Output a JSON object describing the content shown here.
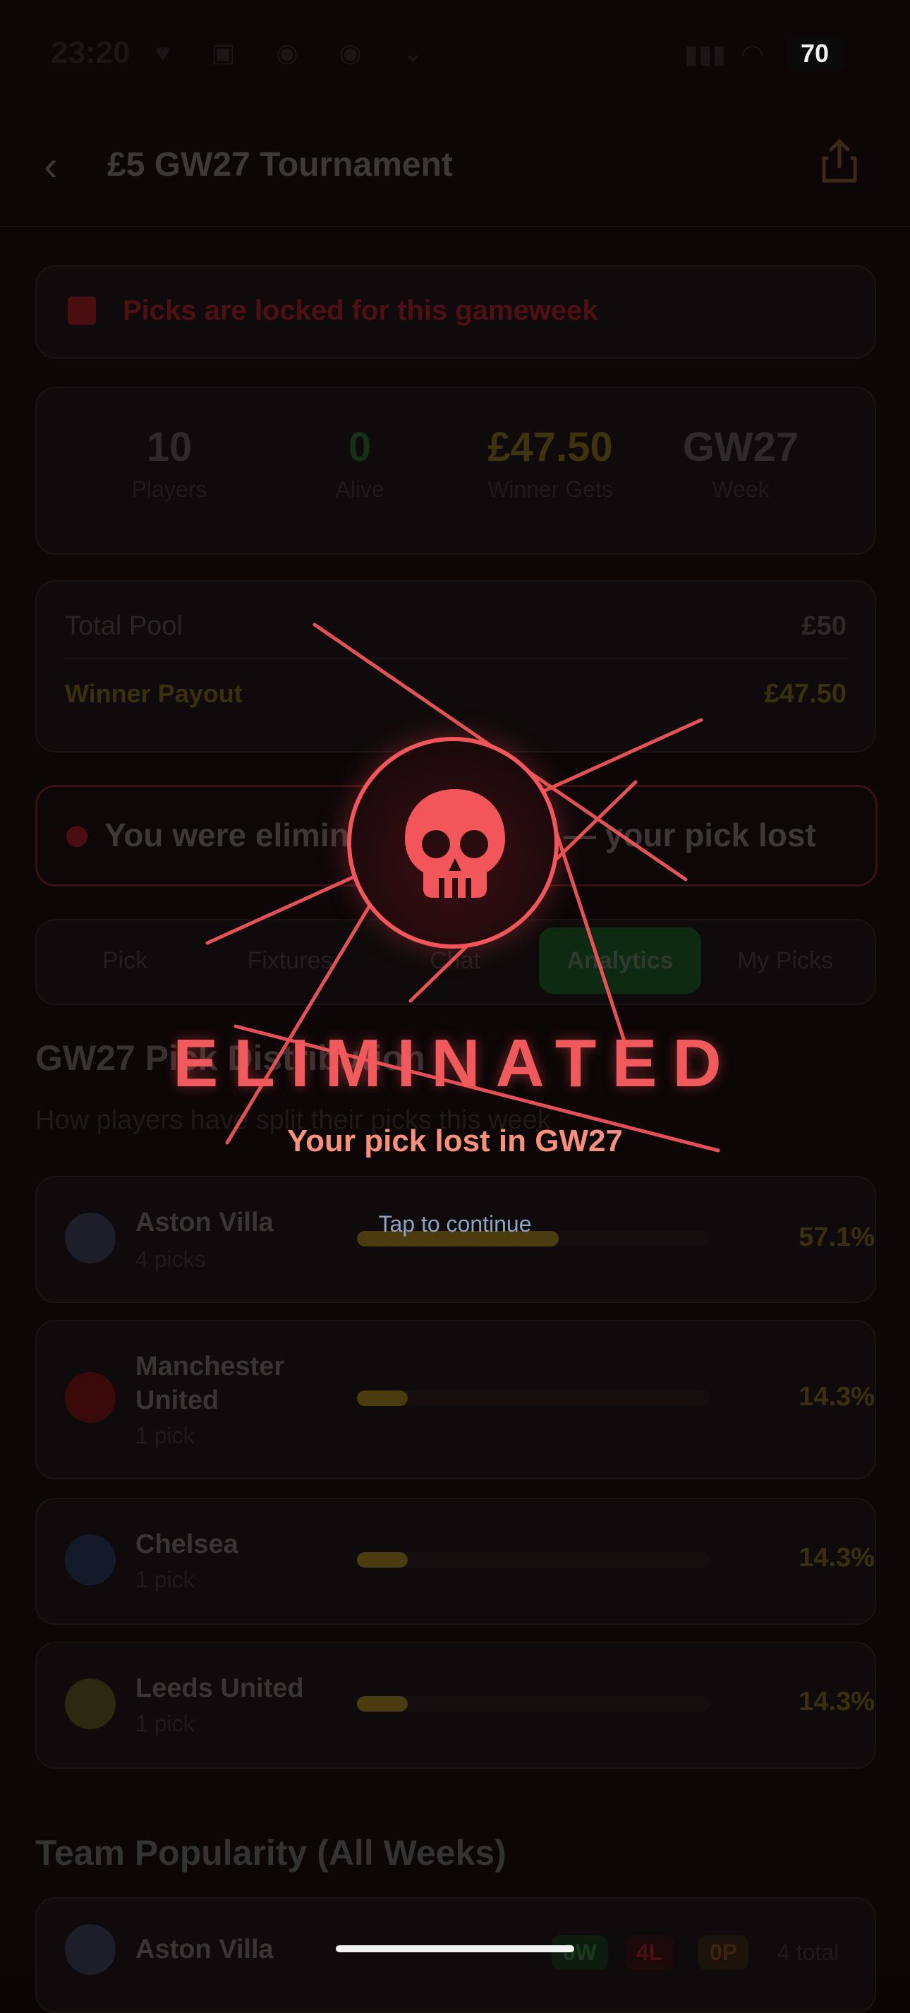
{
  "status_bar": {
    "time": "23:20",
    "battery": "70"
  },
  "header": {
    "back_icon": "chevron-left-icon",
    "title": "£5 GW27 Tournament",
    "share_icon": "share-icon"
  },
  "lock_banner": {
    "text": "Picks are locked for this gameweek",
    "icon": "lock-icon"
  },
  "stats": [
    {
      "value": "10",
      "label": "Players",
      "color": "#2e2a2b"
    },
    {
      "value": "0",
      "label": "Alive",
      "color": "#16301a"
    },
    {
      "value": "£47.50",
      "label": "Winner Gets",
      "color": "#3d330c"
    },
    {
      "value": "GW27",
      "label": "Week",
      "color": "#2e2a2b"
    }
  ],
  "pool": {
    "total_label": "Total Pool",
    "total_value": "£50",
    "payout_label": "Winner Payout",
    "payout_value": "£47.50"
  },
  "eliminated_banner": {
    "text": "You were eliminated in GW27 — your pick lost"
  },
  "tabs": [
    {
      "label": "Pick"
    },
    {
      "label": "Fixtures"
    },
    {
      "label": "Chat"
    },
    {
      "label": "Analytics",
      "active": true
    },
    {
      "label": "My Picks"
    }
  ],
  "distribution": {
    "title": "GW27 Pick Distribution",
    "subtitle": "How players have split their picks this week",
    "teams": [
      {
        "name": "Aston Villa",
        "picks": "4 picks",
        "pct": "57.1%",
        "fraction": 0.571,
        "badge_color": "#1d1e2a"
      },
      {
        "name": "Manchester United",
        "picks": "1 pick",
        "pct": "14.3%",
        "fraction": 0.143,
        "badge_color": "#3a0a0a"
      },
      {
        "name": "Chelsea",
        "picks": "1 pick",
        "pct": "14.3%",
        "fraction": 0.143,
        "badge_color": "#141a2a"
      },
      {
        "name": "Leeds United",
        "picks": "1 pick",
        "pct": "14.3%",
        "fraction": 0.143,
        "badge_color": "#2a2a10"
      }
    ]
  },
  "popularity": {
    "title": "Team Popularity (All Weeks)",
    "first_team": "Aston Villa",
    "wins": "0W",
    "losses": "4L",
    "pending": "0P",
    "total": "4 total"
  },
  "overlay": {
    "icon": "skull-icon",
    "heading": "ELIMINATED",
    "subheading": "Your pick lost in GW27",
    "prompt": "Tap to continue",
    "accent": "#f05a5c"
  }
}
